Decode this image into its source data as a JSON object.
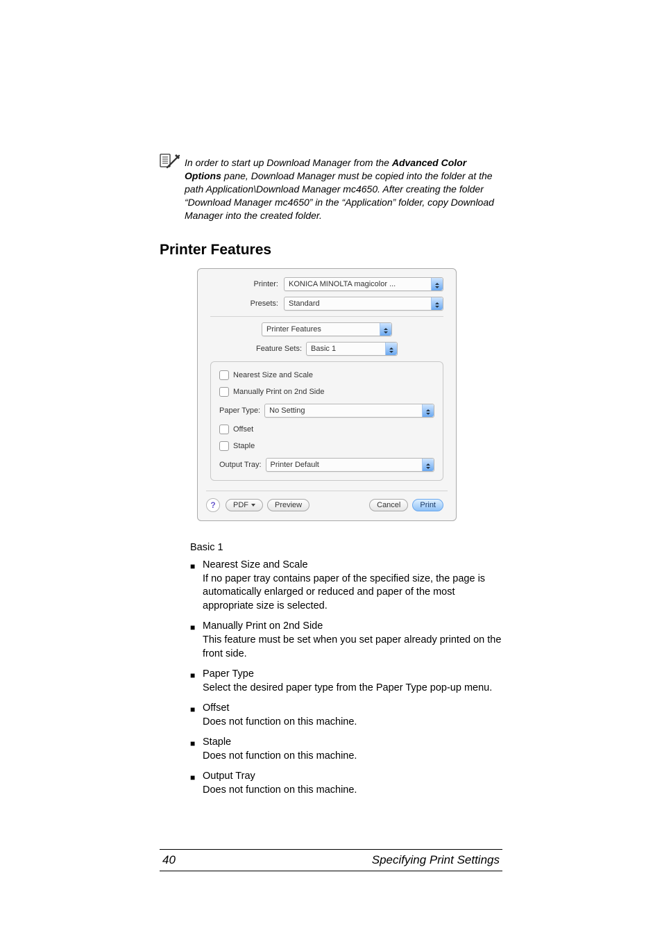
{
  "note": {
    "text_before_bold": "In order to start up Download Manager from the ",
    "bold": "Advanced Color Options",
    "text_after_bold": " pane, Download Manager must be copied into the folder at the path Application\\Download Manager mc4650. After creating the folder “Download Manager mc4650” in the “Application” folder, copy Download Manager into the created folder."
  },
  "section_heading": "Printer Features",
  "dialog": {
    "printer_label": "Printer:",
    "printer_value": "KONICA MINOLTA magicolor ...",
    "presets_label": "Presets:",
    "presets_value": "Standard",
    "pane_value": "Printer Features",
    "feature_sets_label": "Feature Sets:",
    "feature_sets_value": "Basic 1",
    "chk_nearest": "Nearest Size and Scale",
    "chk_manual2nd": "Manually Print on 2nd Side",
    "paper_type_label": "Paper Type:",
    "paper_type_value": "No Setting",
    "chk_offset": "Offset",
    "chk_staple": "Staple",
    "output_tray_label": "Output Tray:",
    "output_tray_value": "Printer Default",
    "help": "?",
    "pdf_btn": "PDF",
    "preview_btn": "Preview",
    "cancel_btn": "Cancel",
    "print_btn": "Print"
  },
  "subhead": "Basic 1",
  "items": [
    {
      "title": "Nearest Size and Scale",
      "desc": "If no paper tray contains paper of the specified size, the page is automatically enlarged or reduced and paper of the most appropriate size is selected."
    },
    {
      "title": "Manually Print on 2nd Side",
      "desc": "This feature must be set when you set paper already printed on the front side."
    },
    {
      "title": "Paper Type",
      "desc": "Select the desired paper type from the Paper Type pop-up menu."
    },
    {
      "title": "Offset",
      "desc": "Does not function on this machine."
    },
    {
      "title": "Staple",
      "desc": "Does not function on this machine."
    },
    {
      "title": "Output Tray",
      "desc": "Does not function on this machine."
    }
  ],
  "footer": {
    "page": "40",
    "title": "Specifying Print Settings"
  }
}
